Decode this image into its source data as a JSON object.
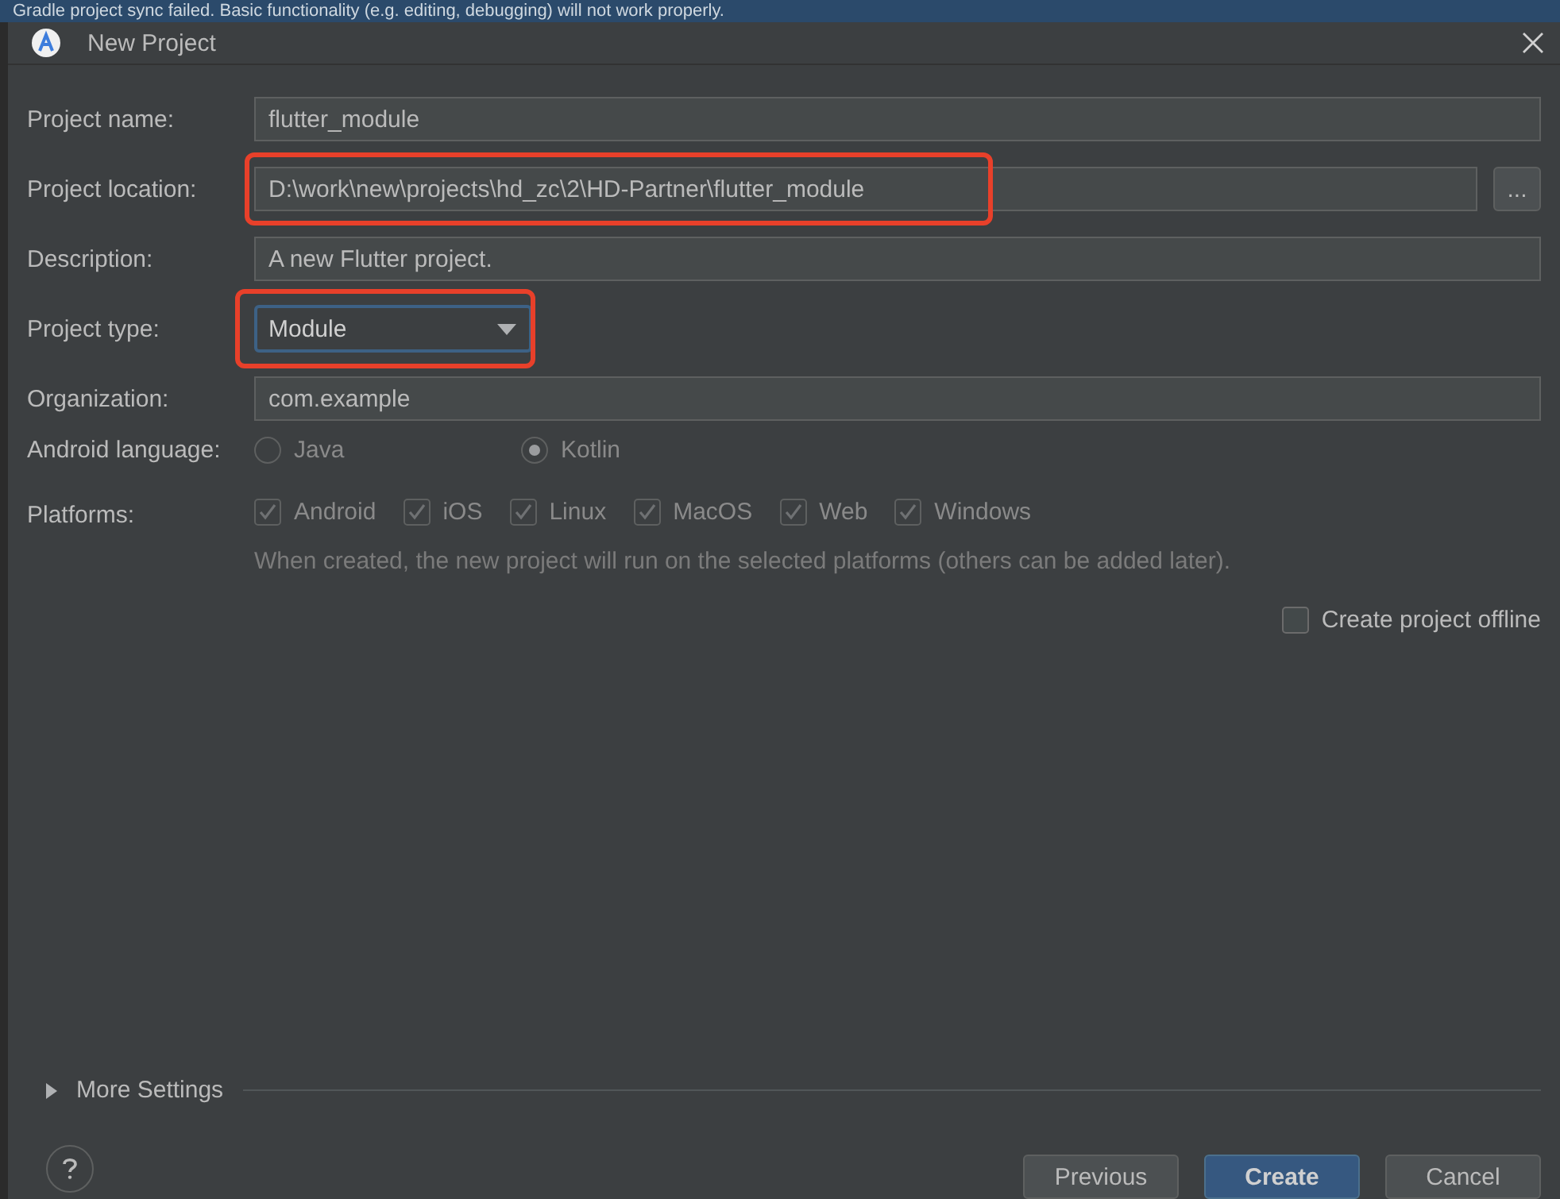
{
  "background_banner": "Gradle project sync failed. Basic functionality (e.g. editing, debugging) will not work properly.",
  "window": {
    "title": "New Project"
  },
  "fields": [
    {
      "label": "Project name:",
      "value": "flutter_module",
      "kind": "text",
      "highlighted": false
    },
    {
      "label": "Project location:",
      "value": "D:\\work\\new\\projects\\hd_zc\\2\\HD-Partner\\flutter_module",
      "kind": "browse",
      "highlighted": true,
      "button": "..."
    },
    {
      "label": "Description:",
      "value": "A new Flutter project.",
      "kind": "text",
      "highlighted": false
    },
    {
      "label": "Project type:",
      "value": "Module",
      "kind": "dropdown",
      "highlighted": true
    },
    {
      "label": "Organization:",
      "value": "com.example",
      "kind": "text",
      "highlighted": false
    }
  ],
  "android_language": {
    "label": "Android language:",
    "disabled": true,
    "options": [
      {
        "label": "Java",
        "selected": false
      },
      {
        "label": "Kotlin",
        "selected": true
      }
    ]
  },
  "platforms": {
    "label": "Platforms:",
    "disabled": true,
    "options": [
      {
        "label": "Android",
        "checked": true
      },
      {
        "label": "iOS",
        "checked": true
      },
      {
        "label": "Linux",
        "checked": true
      },
      {
        "label": "MacOS",
        "checked": true
      },
      {
        "label": "Web",
        "checked": true
      },
      {
        "label": "Windows",
        "checked": true
      }
    ],
    "hint": "When created, the new project will run on the selected platforms (others can be added later)."
  },
  "offline": {
    "label": "Create project offline",
    "checked": false
  },
  "more_settings": {
    "label": "More Settings",
    "expanded": false
  },
  "buttons": [
    {
      "label": "Previous",
      "kind": "normal"
    },
    {
      "label": "Create",
      "kind": "default"
    },
    {
      "label": "Cancel",
      "kind": "normal"
    }
  ]
}
